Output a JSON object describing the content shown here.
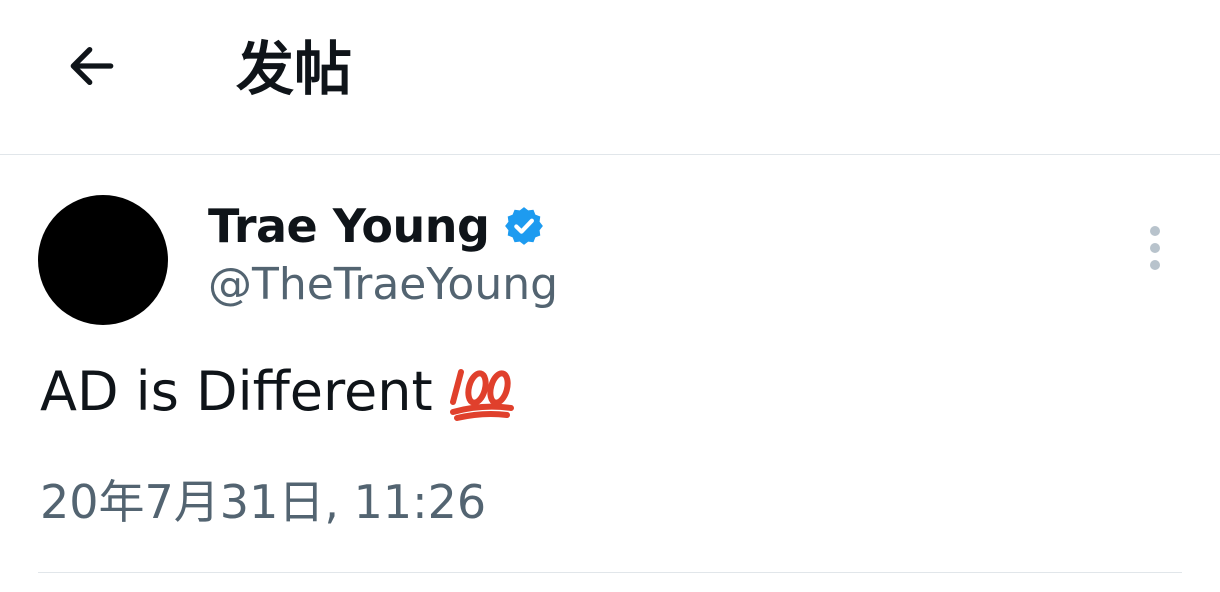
{
  "header": {
    "back_icon": "arrow-left-icon",
    "title": "发帖"
  },
  "post": {
    "author": {
      "display_name": "Trae Young",
      "handle": "@TheTraeYoung",
      "verified": true,
      "verified_color": "#1d9bf0",
      "avatar_color": "#000000"
    },
    "text": "AD is Different",
    "emoji_icon": "hundred-points-icon",
    "emoji_color": "#e0402c",
    "timestamp": "20年7月31日, 11:26",
    "more_icon": "more-vertical-icon"
  },
  "colors": {
    "text_primary": "#0f1419",
    "text_secondary": "#536471",
    "divider": "#e1e6ea"
  }
}
